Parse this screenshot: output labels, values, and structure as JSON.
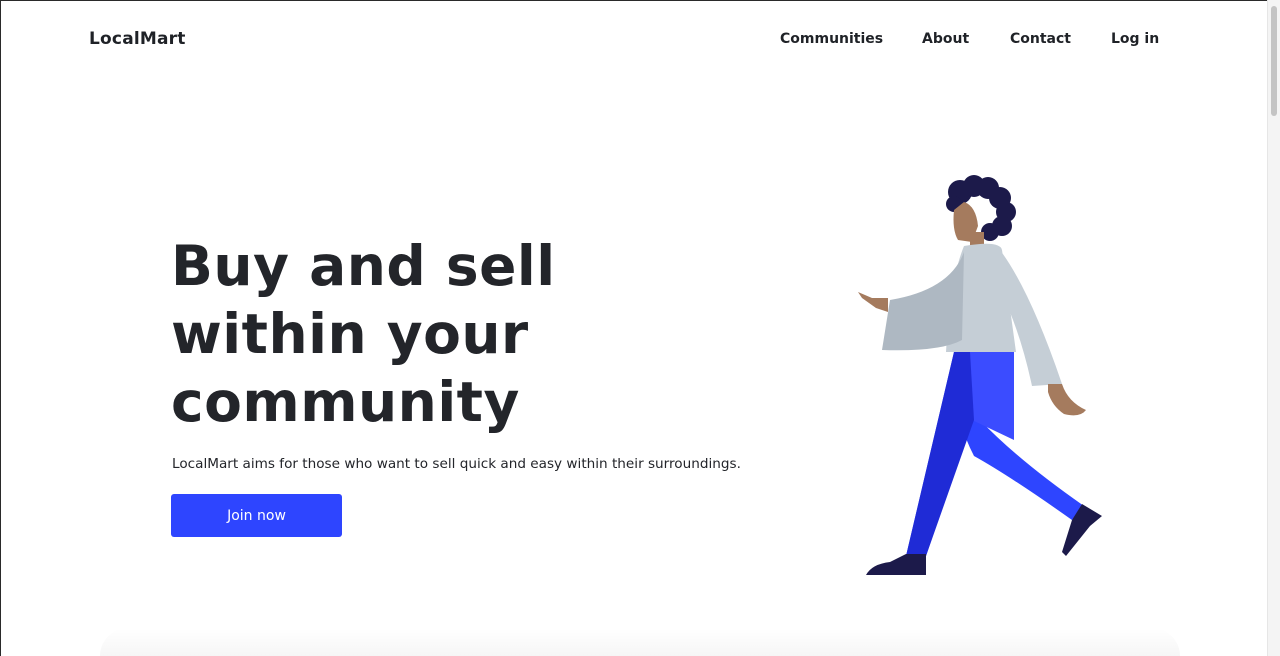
{
  "brand": {
    "name": "LocalMart"
  },
  "nav": {
    "items": [
      {
        "label": "Communities"
      },
      {
        "label": "About"
      },
      {
        "label": "Contact"
      },
      {
        "label": "Log in"
      }
    ]
  },
  "hero": {
    "title": "Buy and sell within your community",
    "subtitle": "LocalMart aims for those who want to sell quick and easy within their surroundings.",
    "cta_label": "Join now"
  },
  "colors": {
    "accent": "#2e45ff",
    "text": "#23252a",
    "illustration_pants": "#2e45ff",
    "illustration_shirt": "#c5ced6",
    "illustration_hair": "#1c1a4a",
    "illustration_skin": "#a57b5e"
  },
  "icons": {
    "hero_illustration": "walking-person-illustration"
  }
}
